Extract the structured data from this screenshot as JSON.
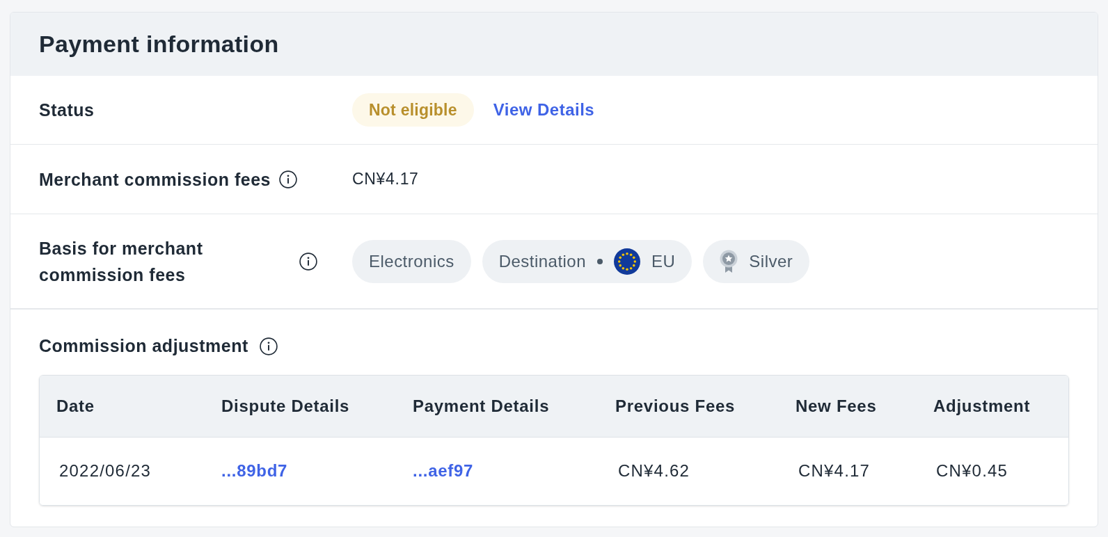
{
  "card": {
    "title": "Payment information"
  },
  "rows": [
    {
      "kind": "status",
      "label": "Status",
      "info": false,
      "badge": "Not eligible",
      "link": "View Details"
    },
    {
      "kind": "value",
      "label": "Merchant commission fees",
      "info": true,
      "value": "CN¥4.17"
    },
    {
      "kind": "chips",
      "label": "Basis for merchant commission fees",
      "info": true,
      "chips": [
        {
          "kind": "text",
          "label": "Electronics"
        },
        {
          "kind": "destination",
          "label": "Destination",
          "region": "EU"
        },
        {
          "kind": "tier",
          "label": "Silver"
        }
      ]
    }
  ],
  "adjustment": {
    "title": "Commission adjustment",
    "info": true,
    "table": {
      "columns": [
        "Date",
        "Dispute Details",
        "Payment Details",
        "Previous Fees",
        "New Fees",
        "Adjustment"
      ],
      "rows": [
        {
          "cells": [
            {
              "kind": "text",
              "text": "2022/06/23"
            },
            {
              "kind": "link",
              "text": "...89bd7"
            },
            {
              "kind": "link",
              "text": "...aef97"
            },
            {
              "kind": "text",
              "text": "CN¥4.62"
            },
            {
              "kind": "text",
              "text": "CN¥4.17"
            },
            {
              "kind": "text",
              "text": "CN¥0.45"
            }
          ]
        }
      ]
    }
  }
}
